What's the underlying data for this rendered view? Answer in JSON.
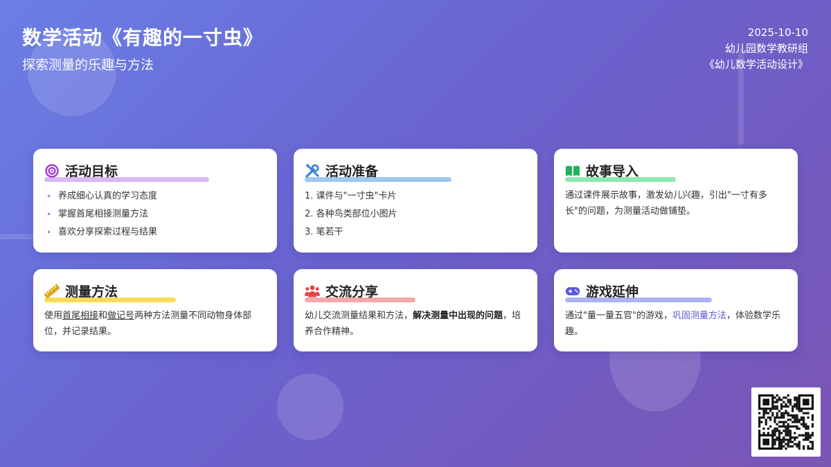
{
  "header": {
    "title": "数学活动《有趣的一寸虫》",
    "subtitle": "探索测量的乐趣与方法",
    "date": "2025-10-10",
    "org": "幼儿园数学教研组",
    "book": "《幼儿数学活动设计》"
  },
  "cards": {
    "goals": {
      "title": "活动目标",
      "icon": "target-icon",
      "highlight": "#d9b8f5",
      "items": [
        "养成细心认真的学习态度",
        "掌握首尾相接测量方法",
        "喜欢分享探索过程与结果"
      ]
    },
    "prep": {
      "title": "活动准备",
      "icon": "tools-icon",
      "highlight": "#9ec8f2",
      "items": [
        "1. 课件与\"一寸虫\"卡片",
        "2. 各种鸟类部位小图片",
        "3. 笔若干"
      ]
    },
    "story": {
      "title": "故事导入",
      "icon": "book-icon",
      "highlight": "#8ee8b0",
      "text": "通过课件展示故事，激发幼儿兴趣，引出\"一寸有多长\"的问题，为测量活动做铺垫。"
    },
    "method": {
      "title": "测量方法",
      "icon": "ruler-icon",
      "highlight": "#f7dc5a",
      "t1": "使用",
      "u1": "首尾相接",
      "t2": "和",
      "u2": "做记号",
      "t3": "两种方法测量不同动物身体部位，并记录结果。"
    },
    "share": {
      "title": "交流分享",
      "icon": "people-icon",
      "highlight": "#f5a9ab",
      "t1": "幼儿交流测量结果和方法，",
      "b1": "解决测量中出现的问题",
      "t2": "，培养合作精神。"
    },
    "game": {
      "title": "游戏延伸",
      "icon": "gamepad-icon",
      "highlight": "#adb2f5",
      "t1": "通过\"量一量五官\"的游戏，",
      "a1": "巩固测量方法",
      "t2": "，体验数学乐趣。"
    }
  },
  "qr": {
    "icon": "qr-code-icon"
  }
}
